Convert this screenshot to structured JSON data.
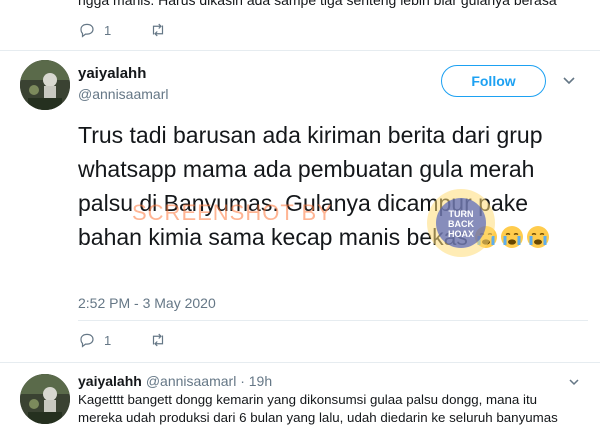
{
  "previous_tweet": {
    "cut_text": "ngga manis. Harus dikasih ada sampe tiga senteng lebih biar gulanya berasa",
    "reply_count": "1"
  },
  "tweet": {
    "display_name": "yaiyalahh",
    "handle": "@annisaamarl",
    "follow_label": "Follow",
    "text": "Trus tadi barusan ada kiriman berita dari grup whatsapp mama ada pembuatan gula merah palsu di Banyumas. Gulanya dicampur pake bahan kimia sama kecap manis bekas",
    "emoji": [
      "crying-face",
      "crying-face",
      "crying-face"
    ],
    "timestamp": "2:52 PM - 3 May 2020",
    "reply_count": "1"
  },
  "watermark": {
    "text": "SCREENSHOT BY",
    "seal_lines": [
      "TURN",
      "BACK",
      "HOAX"
    ]
  },
  "reply": {
    "display_name": "yaiyalahh",
    "handle_time": "@annisaamarl · 19h",
    "text_line1": "Kagetttt bangett dongg kemarin yang dikonsumsi gulaa palsu dongg, mana itu",
    "text_line2": "mereka udah produksi dari 6 bulan yang lalu, udah diedarin ke seluruh banyumas"
  },
  "colors": {
    "accent": "#1da1f2",
    "secondary_text": "#657786",
    "divider": "#e6ecf0",
    "watermark": "#ff783c"
  }
}
